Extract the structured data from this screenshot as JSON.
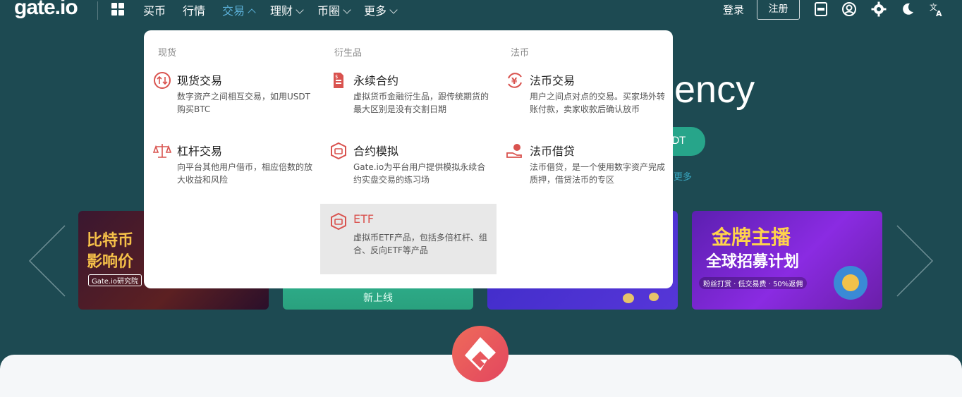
{
  "nav": {
    "logo": "gate.io",
    "items": [
      {
        "label": "买币"
      },
      {
        "label": "行情"
      },
      {
        "label": "交易"
      },
      {
        "label": "理财"
      },
      {
        "label": "币圈"
      },
      {
        "label": "更多"
      }
    ],
    "login": "登录",
    "register": "注册",
    "icons": [
      "app-download-icon",
      "user-icon",
      "settings-icon",
      "dark-mode-icon",
      "language-icon"
    ]
  },
  "hero": {
    "title_fragment": "ency",
    "button_fragment": "DT",
    "more_fragment": "更多"
  },
  "banners": [
    {
      "line1": "比特币",
      "line2": "影响价",
      "sub": "Gate.io研究院"
    },
    {
      "label": "新上线"
    },
    {},
    {
      "line1": "金牌主播",
      "line2": "全球招募计划",
      "sub": "粉丝打赏 · 低交易费 · 50%返佣"
    }
  ],
  "dropdown": {
    "columns": [
      {
        "header": "现货",
        "items": [
          {
            "title": "现货交易",
            "desc": "数字资产之间相互交易，如用USDT购买BTC",
            "icon": "spot-exchange-icon"
          },
          {
            "title": "杠杆交易",
            "desc": "向平台其他用户借币，相应倍数的放大收益和风险",
            "icon": "scale-icon"
          }
        ]
      },
      {
        "header": "衍生品",
        "items": [
          {
            "title": "永续合约",
            "desc": "虚拟货币金融衍生品，跟传统期货的最大区别是没有交割日期",
            "icon": "contract-doc-icon"
          },
          {
            "title": "合约模拟",
            "desc": "Gate.io为平台用户提供模拟永续合约实盘交易的练习场",
            "icon": "simulation-icon"
          },
          {
            "title": "ETF",
            "desc": "虚拟币ETF产品，包括多倍杠杆、组合、反向ETF等产品",
            "icon": "etf-icon"
          }
        ]
      },
      {
        "header": "法币",
        "items": [
          {
            "title": "法币交易",
            "desc": "用户之间点对点的交易。买家场外转账付款，卖家收款后确认放币",
            "icon": "yen-exchange-icon"
          },
          {
            "title": "法币借贷",
            "desc": "法币借贷，是一个使用数字资产完成质押，借贷法币的专区",
            "icon": "hand-coin-icon"
          }
        ]
      }
    ]
  },
  "colors": {
    "background": "#1d4a52",
    "accent_active": "#5bb0d8",
    "icon_red": "#d9534f",
    "dropdown_highlight": "#e8e8e8"
  }
}
